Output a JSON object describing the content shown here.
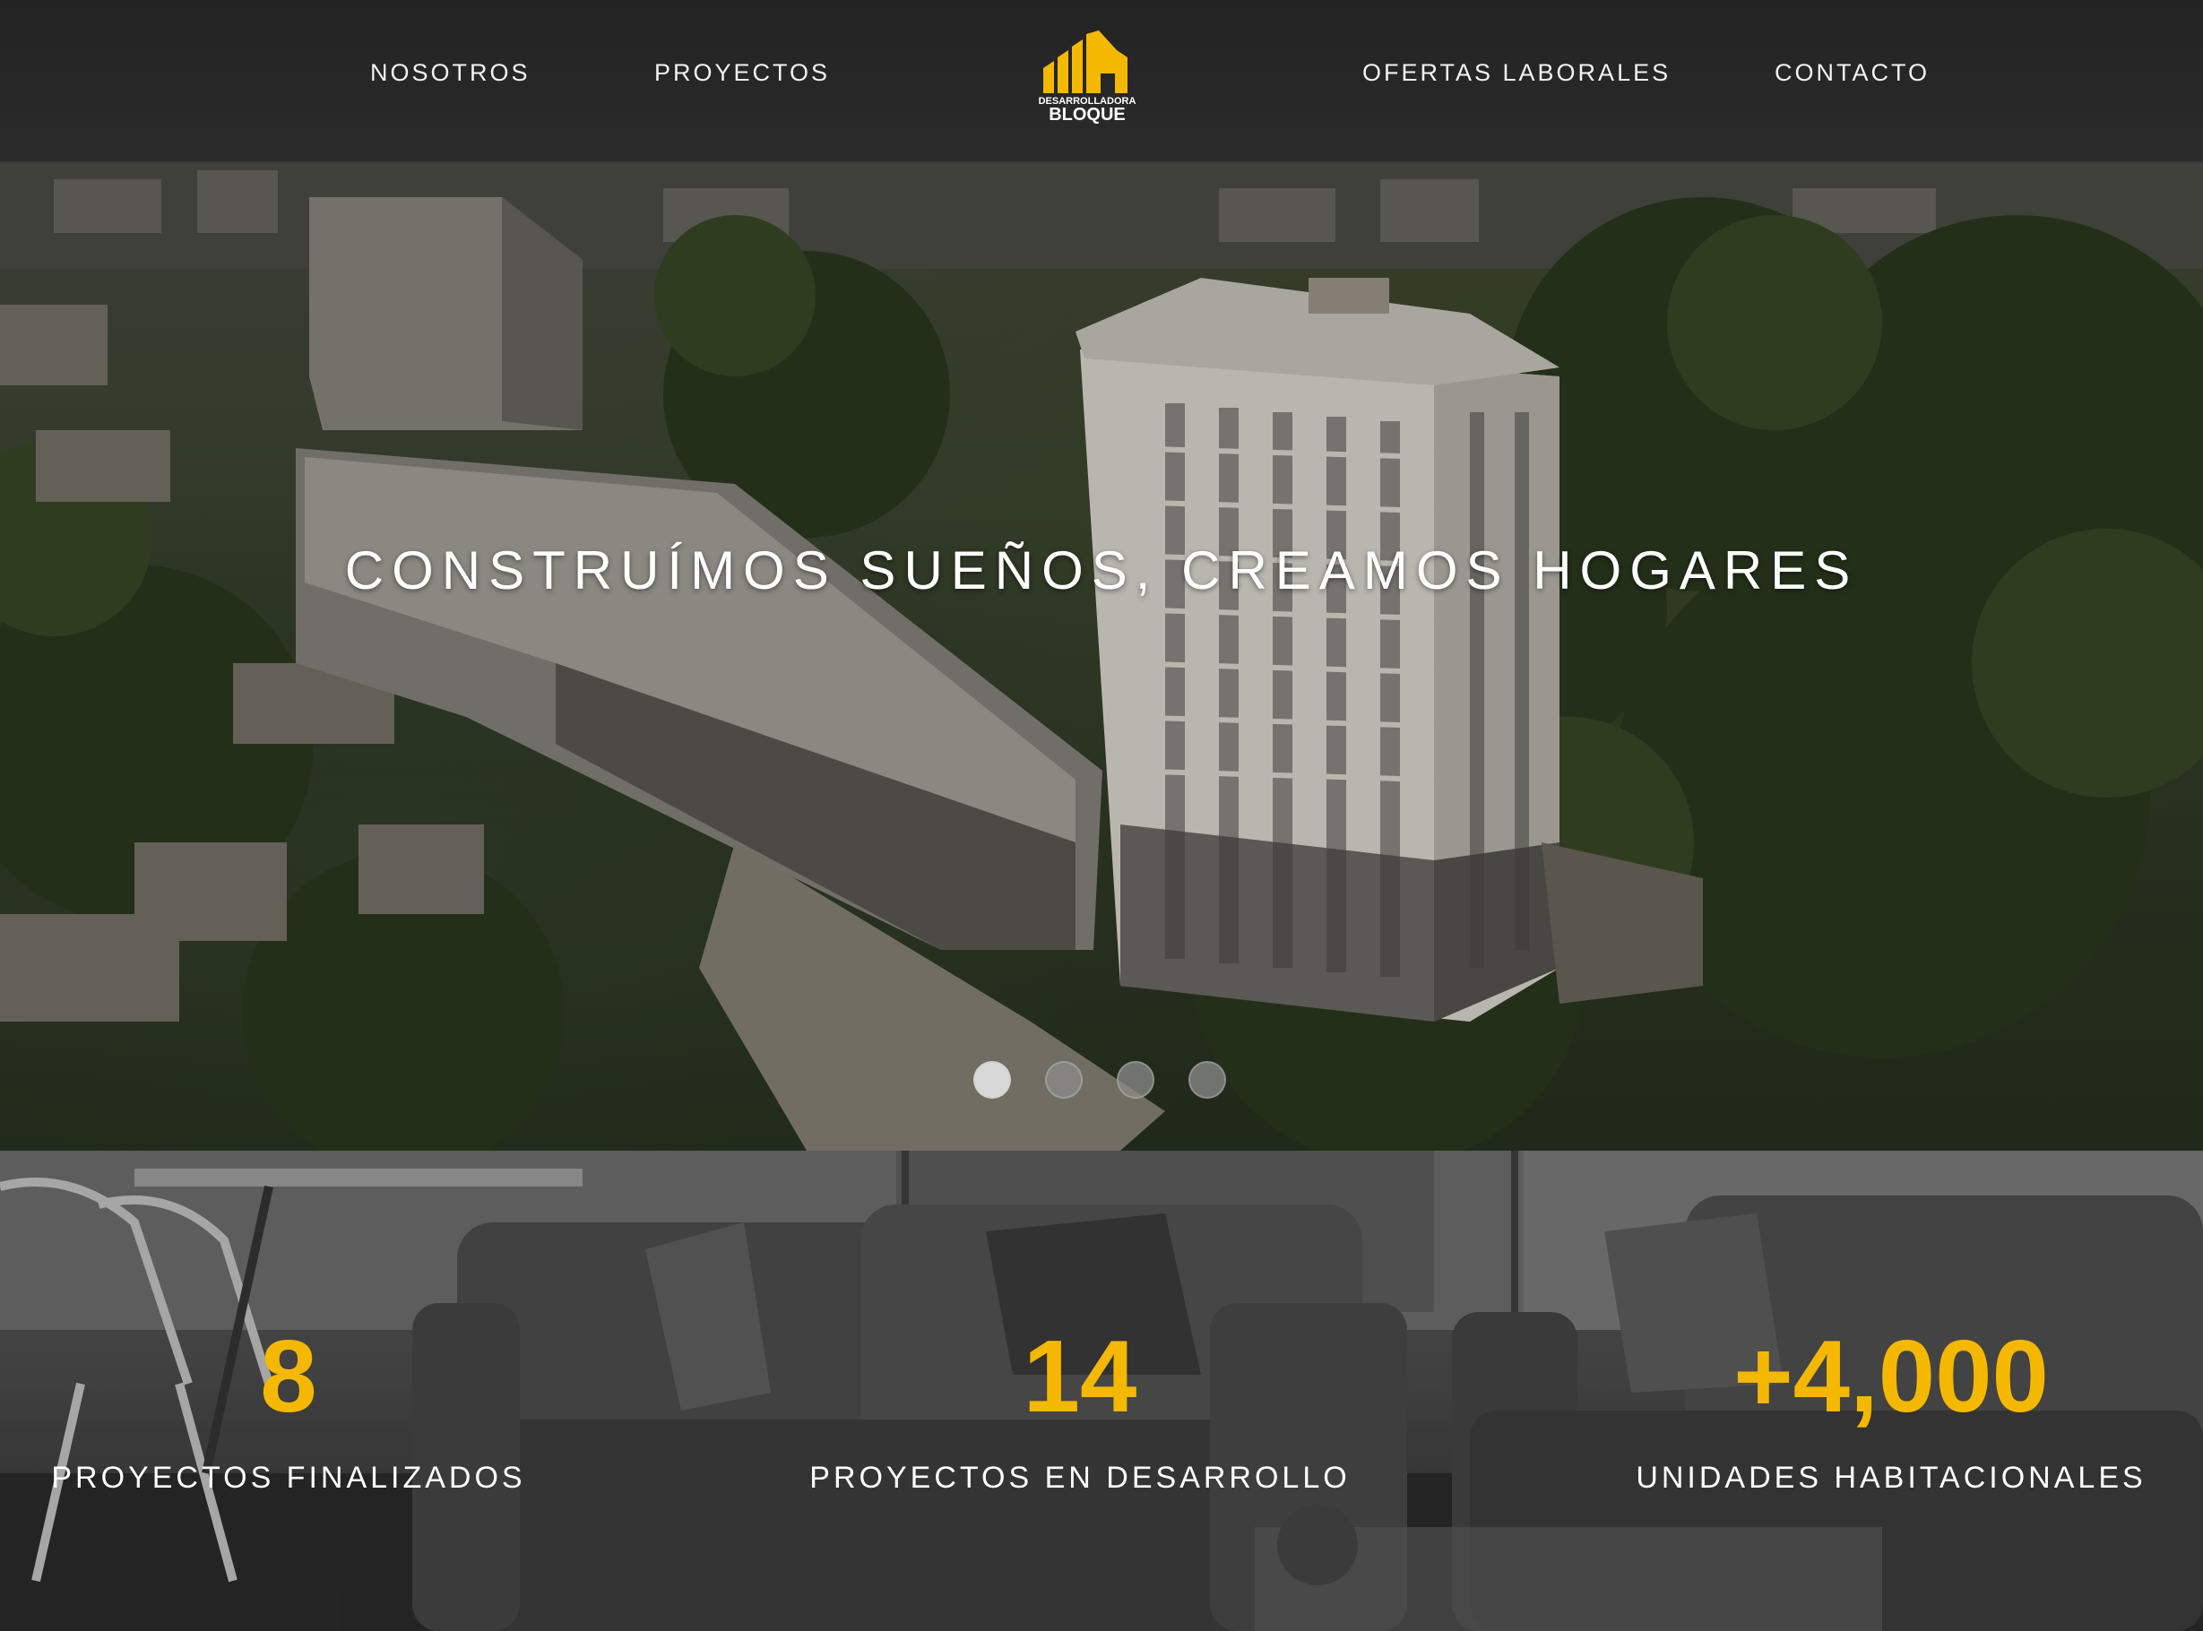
{
  "header": {
    "nav_left": [
      "NOSOTROS",
      "PROYECTOS"
    ],
    "nav_right": [
      "OFERTAS LABORALES",
      "CONTACTO"
    ],
    "logo": {
      "line1": "DESARROLLADORA",
      "line2": "BLOQUE",
      "color": "#f5b800"
    }
  },
  "hero": {
    "title": "CONSTRUÍMOS SUEÑOS, CREAMOS HOGARES",
    "slides": 4,
    "active_slide": 1
  },
  "stats": [
    {
      "number": "8",
      "label": "PROYECTOS FINALIZADOS"
    },
    {
      "number": "14",
      "label": "PROYECTOS EN DESARROLLO"
    },
    {
      "number": "+4,000",
      "label": "UNIDADES HABITACIONALES"
    }
  ],
  "colors": {
    "accent": "#f5b800",
    "header_bg": "#242424"
  }
}
